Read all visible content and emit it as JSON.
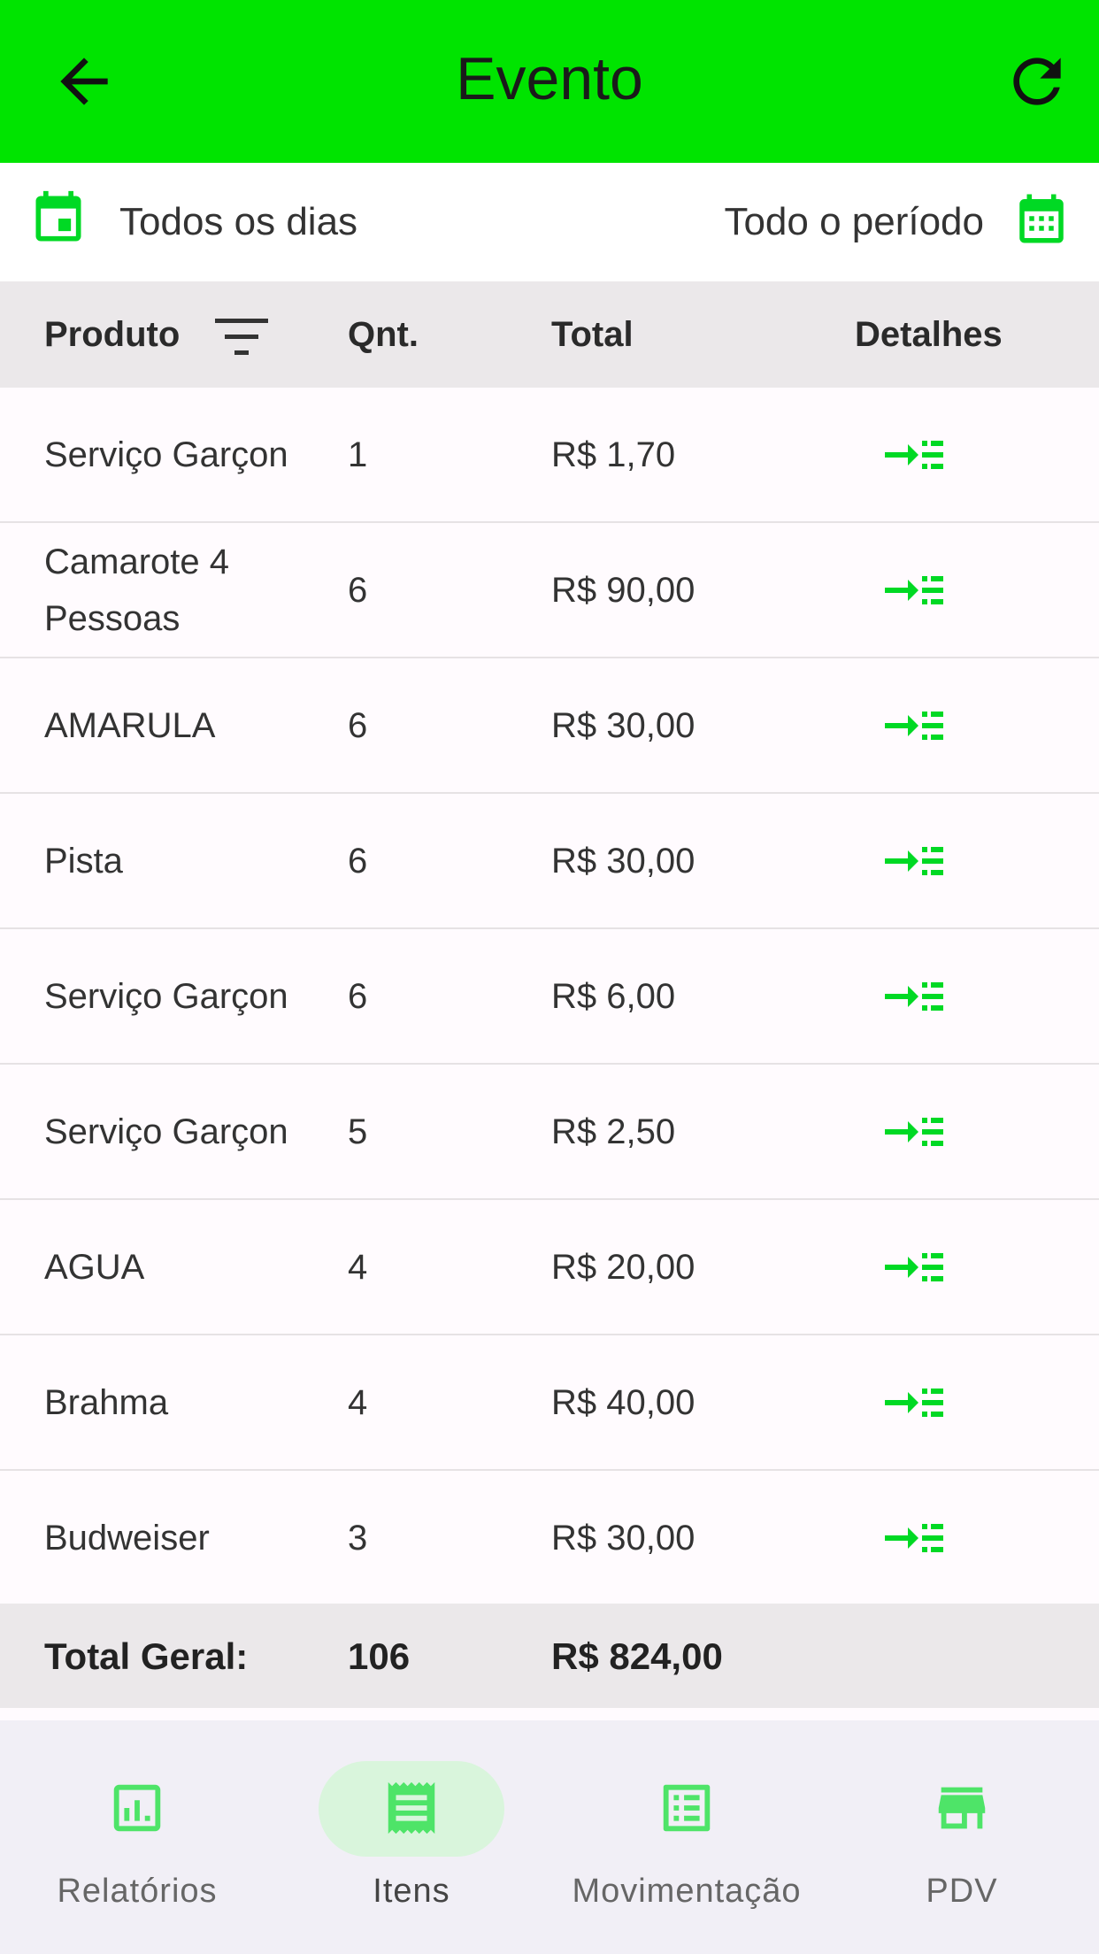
{
  "appbar": {
    "title": "Evento",
    "back_icon": "arrow-back-icon",
    "refresh_icon": "refresh-icon"
  },
  "date_filter": {
    "left_label": "Todos os dias",
    "right_label": "Todo o período"
  },
  "table": {
    "headers": {
      "produto": "Produto",
      "qnt": "Qnt.",
      "total": "Total",
      "detalhes": "Detalhes"
    },
    "rows": [
      {
        "produto": "Serviço Garçon",
        "qnt": "1",
        "total": "R$ 1,70"
      },
      {
        "produto": "Camarote 4 Pessoas",
        "qnt": "6",
        "total": "R$ 90,00"
      },
      {
        "produto": "AMARULA",
        "qnt": "6",
        "total": "R$ 30,00"
      },
      {
        "produto": "Pista",
        "qnt": "6",
        "total": "R$ 30,00"
      },
      {
        "produto": "Serviço Garçon",
        "qnt": "6",
        "total": "R$ 6,00"
      },
      {
        "produto": "Serviço Garçon",
        "qnt": "5",
        "total": "R$ 2,50"
      },
      {
        "produto": "AGUA",
        "qnt": "4",
        "total": "R$ 20,00"
      },
      {
        "produto": "Brahma",
        "qnt": "4",
        "total": "R$ 40,00"
      },
      {
        "produto": "Budweiser",
        "qnt": "3",
        "total": "R$ 30,00"
      }
    ],
    "footer": {
      "label": "Total Geral:",
      "qnt": "106",
      "total": "R$ 824,00"
    }
  },
  "bottom_nav": {
    "items": [
      {
        "label": "Relatórios",
        "icon": "report-chart-icon",
        "active": false
      },
      {
        "label": "Itens",
        "icon": "receipt-icon",
        "active": true
      },
      {
        "label": "Movimentação",
        "icon": "list-alt-icon",
        "active": false
      },
      {
        "label": "PDV",
        "icon": "store-icon",
        "active": false
      }
    ]
  },
  "colors": {
    "accent": "#00e400",
    "header_bg": "#ebe8ea",
    "nav_bg": "#f1eff6",
    "nav_icon": "#4ee468"
  }
}
